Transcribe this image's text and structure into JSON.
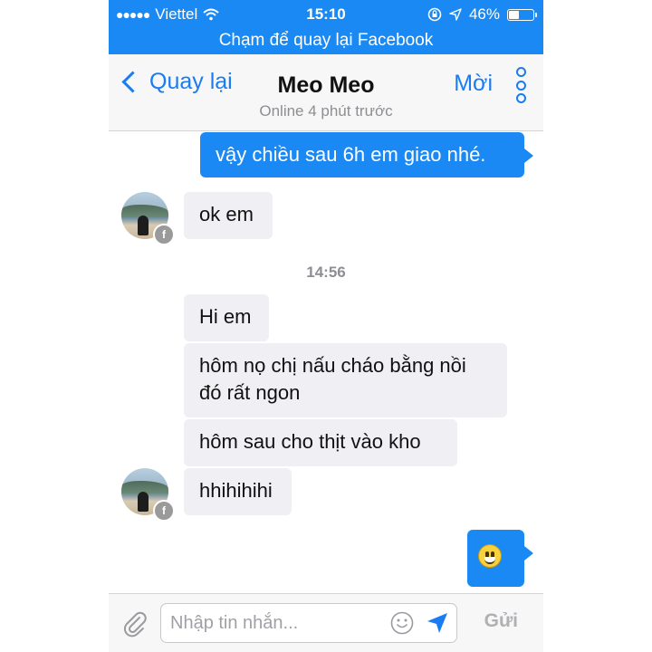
{
  "status": {
    "carrier": "Viettel",
    "signal_dots": "●●●●●",
    "time": "15:10",
    "battery": "46%",
    "battery_level": 0.46
  },
  "return_bar": {
    "label": "Chạm để quay lại Facebook"
  },
  "nav": {
    "back_label": "Quay lại",
    "title": "Meo Meo",
    "subtitle": "Online 4 phút trước",
    "invite_label": "Mời"
  },
  "messages": {
    "m1": "vậy chiều sau 6h em giao nhé.",
    "m2": "ok em",
    "timestamp": "14:56",
    "m3": "Hi em",
    "m4_line1": "hôm nọ chị nấu cháo bằng nồi",
    "m4_line2": "đó rất ngon",
    "m5": "hôm sau cho thịt vào kho",
    "m6": "hhihihihi"
  },
  "composer": {
    "placeholder": "Nhập tin nhắn...",
    "send_label": "Gửi"
  },
  "colors": {
    "accent": "#1b89f3",
    "incoming_bubble": "#efeff4"
  }
}
